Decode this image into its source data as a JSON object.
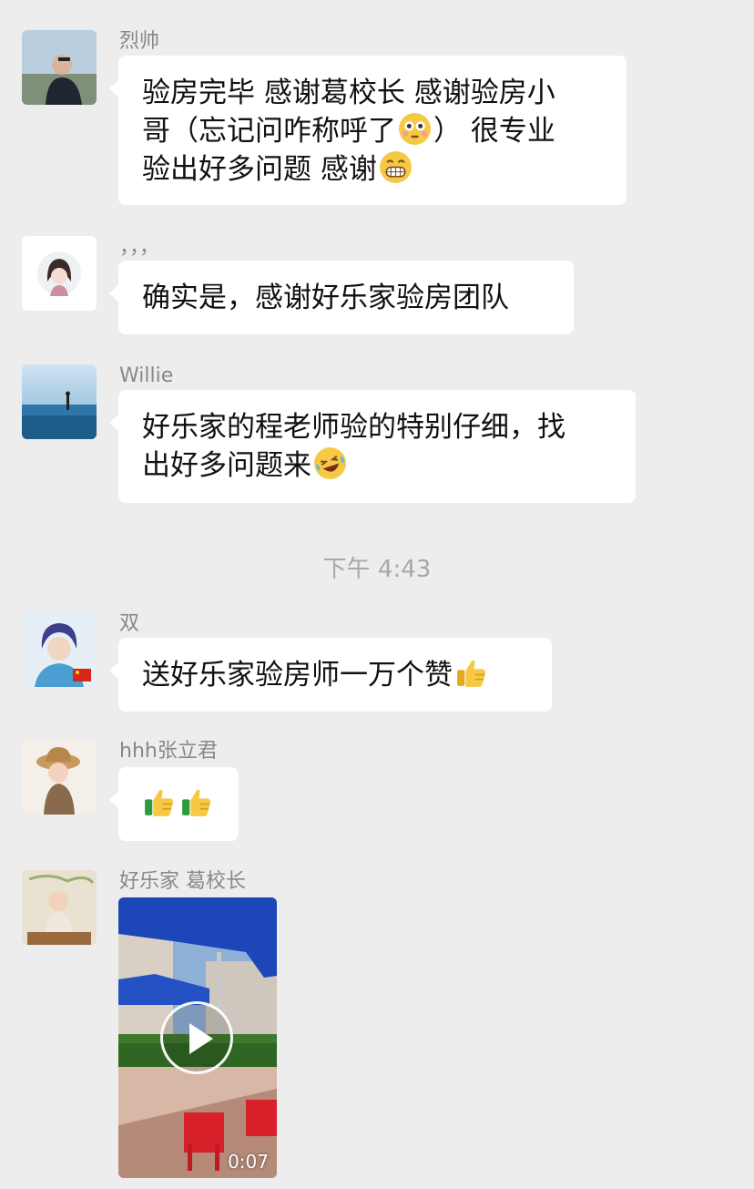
{
  "messages": [
    {
      "sender": "烈帅",
      "text_parts": [
        "验房完毕 感谢葛校长 感谢验房小",
        "哥（忘记问咋称呼了",
        "） 很专业",
        "验出好多问题 感谢"
      ],
      "emojis": [
        "flushed-emoji",
        "grinning-emoji"
      ]
    },
    {
      "sender": "，，，",
      "text": "确实是，感谢好乐家验房团队"
    },
    {
      "sender": "Willie",
      "text_parts": [
        "好乐家的程老师验的特别仔细，找",
        "出好多问题来"
      ],
      "emojis": [
        "laughing-tears-emoji"
      ]
    },
    {
      "sender": "双",
      "text": "送好乐家验房师一万个赞",
      "emojis": [
        "thumbs-up-emoji"
      ]
    },
    {
      "sender": "hhh张立君",
      "emojis": [
        "thumbs-up-emoji",
        "thumbs-up-emoji"
      ]
    },
    {
      "sender": "好乐家 葛校长",
      "video": {
        "duration": "0:07"
      }
    }
  ],
  "timestamp": "下午 4:43",
  "colors": {
    "background": "#ededed",
    "bubble": "#ffffff",
    "sender_text": "#888888",
    "timestamp_text": "#a8a8a8"
  }
}
